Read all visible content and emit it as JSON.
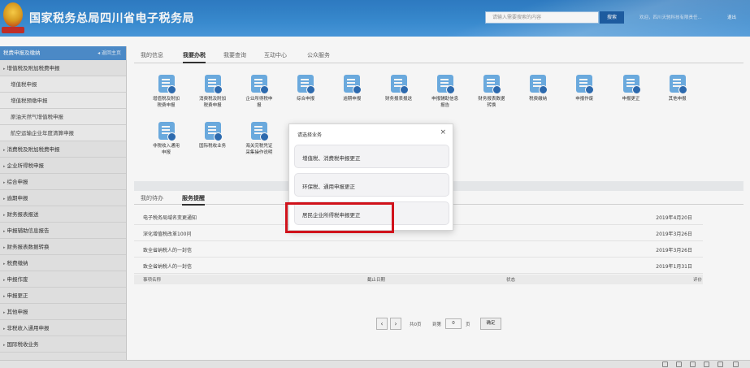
{
  "header": {
    "site_title": "国家税务总局四川省电子税务局",
    "search_placeholder": "请输入需要搜索的内容",
    "search_button": "搜索",
    "welcome_text": "欢迎，四川天驰科技有限责任...",
    "logout": "退出"
  },
  "sidebar": {
    "title": "税费申报及缴纳",
    "back_label": "返回主页",
    "items": [
      {
        "label": "增值税及附加税费申报",
        "type": "group"
      },
      {
        "label": "增值税申报",
        "type": "sub"
      },
      {
        "label": "增值税预缴申报",
        "type": "sub"
      },
      {
        "label": "原油天然气增值税申报",
        "type": "sub"
      },
      {
        "label": "航空运输企业年度清算申报",
        "type": "sub"
      },
      {
        "label": "消费税及附加税费申报",
        "type": "group"
      },
      {
        "label": "企业所得税申报",
        "type": "group"
      },
      {
        "label": "综合申报",
        "type": "group"
      },
      {
        "label": "逾期申报",
        "type": "group"
      },
      {
        "label": "财务报表报送",
        "type": "group"
      },
      {
        "label": "申报辅助信息报告",
        "type": "group"
      },
      {
        "label": "财务报表数据转换",
        "type": "group"
      },
      {
        "label": "税费缴纳",
        "type": "group"
      },
      {
        "label": "申报作废",
        "type": "group"
      },
      {
        "label": "申报更正",
        "type": "group"
      },
      {
        "label": "其他申报",
        "type": "group"
      },
      {
        "label": "非税收入通用申报",
        "type": "group"
      },
      {
        "label": "国际税收业务",
        "type": "group"
      }
    ]
  },
  "main_tabs": [
    "我的信息",
    "我要办税",
    "我要查询",
    "互动中心",
    "公众服务"
  ],
  "active_main_tab": 1,
  "tiles": [
    [
      "增值税及附加",
      "税费申报"
    ],
    [
      "消费税及附加",
      "税费申报"
    ],
    [
      "企业所得税申",
      "报"
    ],
    [
      "综合申报"
    ],
    [
      "逾期申报"
    ],
    [
      "财务报表报送"
    ],
    [
      "申报辅助信息",
      "报告"
    ],
    [
      "财务报表数据",
      "转换"
    ],
    [
      "税费缴纳"
    ],
    [
      "申报作废"
    ],
    [
      "申报更正"
    ],
    [
      "其他申报"
    ],
    [
      "非税收入通用",
      "申报"
    ],
    [
      "国际税收业务"
    ],
    [
      "海关完税凭证",
      "采集操作说明"
    ]
  ],
  "notice_tabs": [
    "我的待办",
    "服务提醒"
  ],
  "active_notice_tab": 1,
  "notices": [
    {
      "title": "电子税务局域名变更通知",
      "date": "2019年4月20日"
    },
    {
      "title": "深化增值税改革100问",
      "date": "2019年3月26日"
    },
    {
      "title": "致全省纳税人的一封信",
      "date": "2019年3月26日"
    },
    {
      "title": "致全省纳税人的一封信",
      "date": "2019年1月31日"
    }
  ],
  "table_headers": [
    "事项名称",
    "截止日期",
    "状态",
    "评价"
  ],
  "pager": {
    "prev": "‹",
    "next": "›",
    "total_text": "共0页",
    "goto_text": "到第",
    "page_value": "0",
    "page_unit": "页",
    "confirm": "确定"
  },
  "modal": {
    "title": "请选择业务",
    "close": "×",
    "options": [
      "增值税、消费税申报更正",
      "环保税、通用申报更正",
      "居民企业所得税申报更正"
    ]
  },
  "colors": {
    "header_blue": "#3b8fd6",
    "sidebar_head": "#4f8fcf",
    "highlight_red": "#d0121b"
  }
}
